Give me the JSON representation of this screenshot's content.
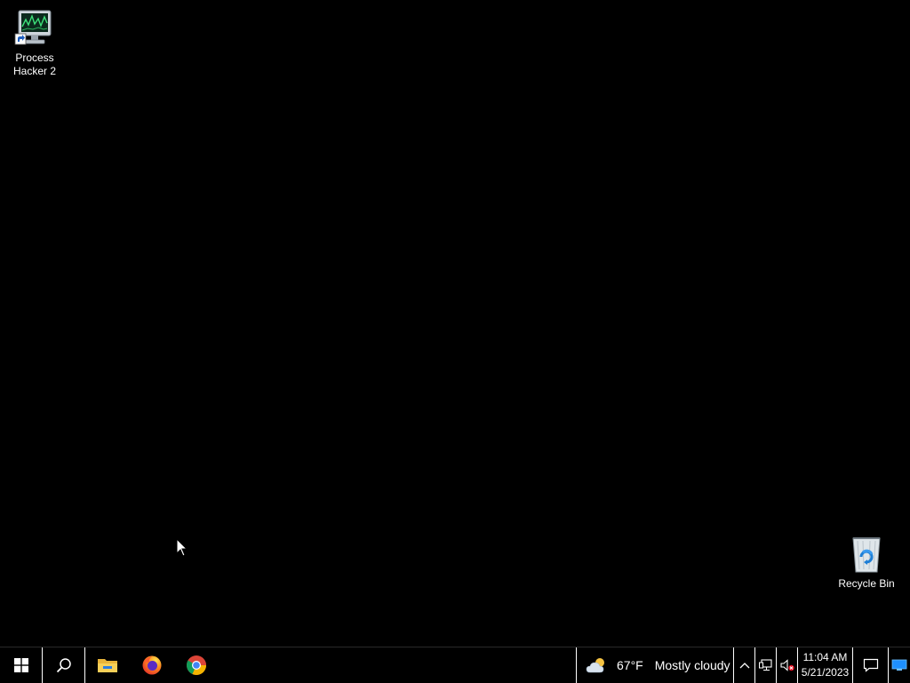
{
  "desktop": {
    "icons": [
      {
        "label": "Process\nHacker 2",
        "icon": "process-hacker-icon",
        "shortcut": true
      },
      {
        "label": "Recycle Bin",
        "icon": "recycle-bin-icon",
        "shortcut": false
      }
    ]
  },
  "taskbar": {
    "start_icon": "windows-logo-icon",
    "search_icon": "search-icon",
    "pinned_apps": [
      {
        "name": "File Explorer",
        "icon": "file-explorer-icon"
      },
      {
        "name": "Firefox",
        "icon": "firefox-icon"
      },
      {
        "name": "Google Chrome",
        "icon": "chrome-icon"
      }
    ],
    "weather": {
      "icon": "partly-cloudy-icon",
      "temperature": "67°F",
      "condition": "Mostly cloudy"
    },
    "tray": {
      "overflow_icon": "chevron-up-icon",
      "network_icon": "network-icon",
      "volume_icon": "volume-muted-icon"
    },
    "clock": {
      "time": "11:04 AM",
      "date": "5/21/2023"
    },
    "notification_icon": "action-center-icon",
    "show_desktop_icon": "show-desktop-icon"
  },
  "colors": {
    "desktop_background": "#000000",
    "taskbar_background": "#000000",
    "separator": "#ffffff",
    "text": "#ffffff"
  }
}
